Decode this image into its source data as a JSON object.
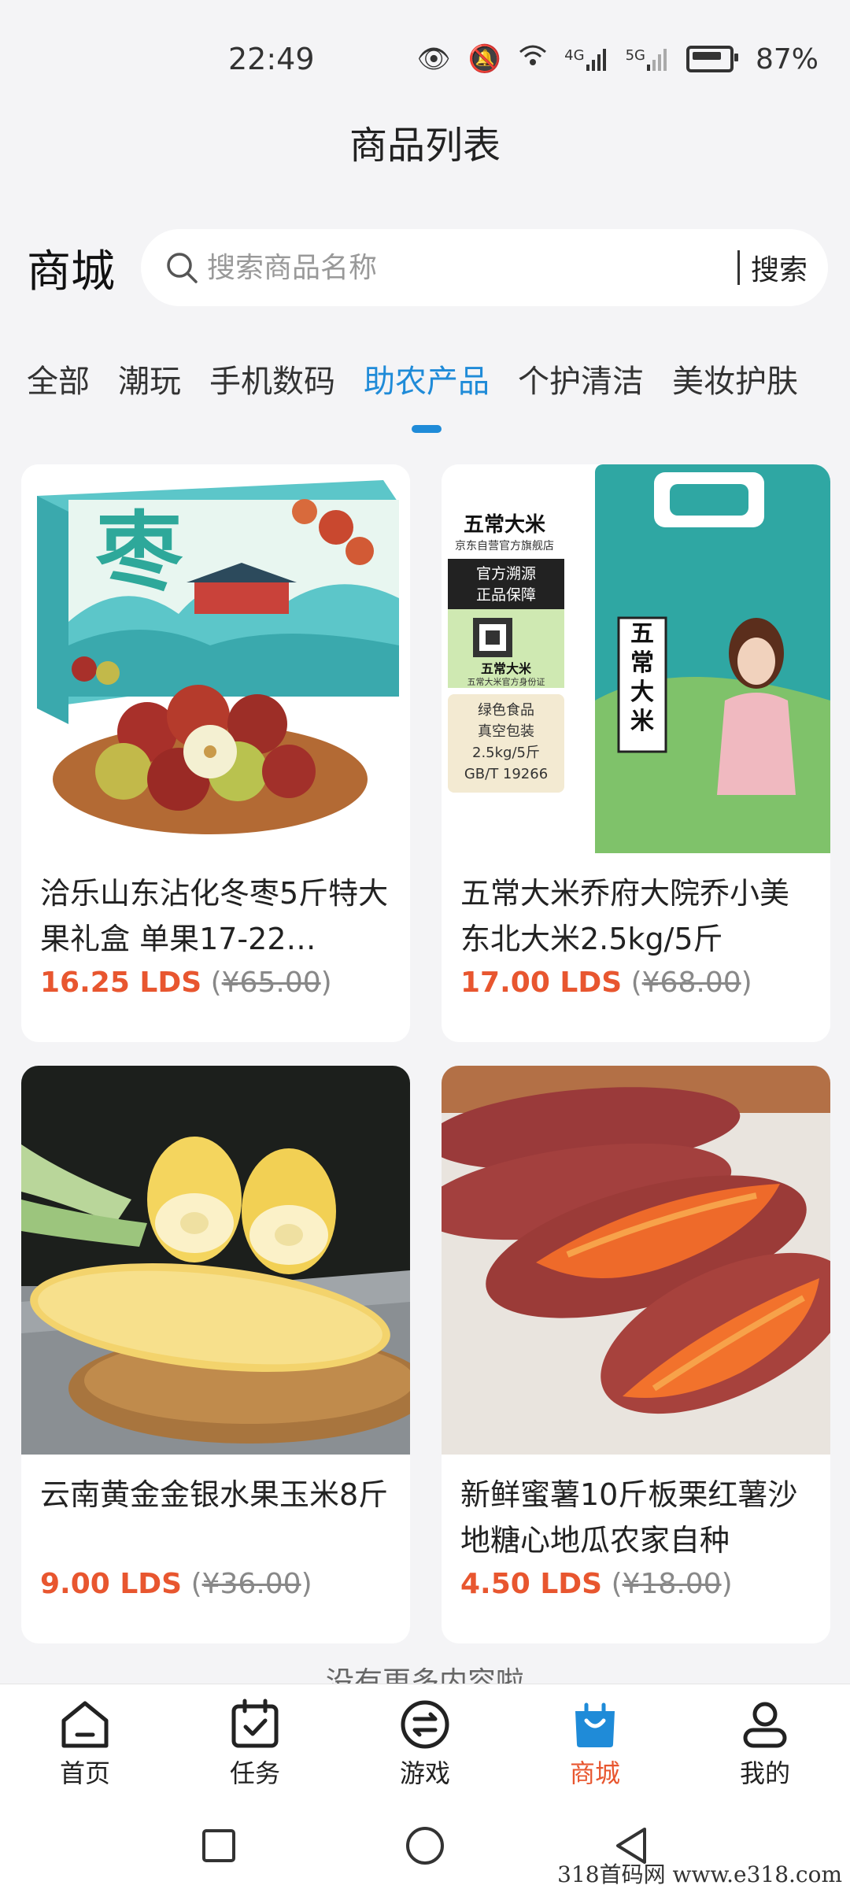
{
  "status_bar": {
    "time": "22:49",
    "network_1": "4G",
    "network_2": "5G",
    "battery": "87%"
  },
  "header": {
    "title": "商品列表"
  },
  "search": {
    "label": "商城",
    "placeholder": "搜索商品名称",
    "button": "搜索"
  },
  "tabs": [
    {
      "label": "全部",
      "active": false
    },
    {
      "label": "潮玩",
      "active": false
    },
    {
      "label": "手机数码",
      "active": false
    },
    {
      "label": "助农产品",
      "active": true
    },
    {
      "label": "个护清洁",
      "active": false
    },
    {
      "label": "美妆护肤",
      "active": false
    }
  ],
  "products": [
    {
      "name": "洽乐山东沾化冬枣5斤特大果礼盒 单果17-22…",
      "price": "16.25 LDS",
      "original": "¥65.00",
      "image": "winter-jujube-gift-box",
      "image_text": "枣"
    },
    {
      "name": "五常大米乔府大院乔小美东北大米2.5kg/5斤",
      "price": "17.00 LDS",
      "original": "¥68.00",
      "image": "wuchang-rice-bag",
      "image_text": {
        "brand": "五常大米",
        "store": "京东自营官方旗舰店",
        "badge": "官方溯源 正品保障",
        "id_brand": "五常大米",
        "id_text": "五常大米官方身份证",
        "spec_1": "绿色食品",
        "spec_2": "真空包装",
        "spec_3": "2.5kg/5斤",
        "spec_4": "GB/T 19266",
        "bag_title": "五常大米"
      }
    },
    {
      "name": "云南黄金金银水果玉米8斤",
      "price": "9.00 LDS",
      "original": "¥36.00",
      "image": "yellow-white-corn"
    },
    {
      "name": "新鲜蜜薯10斤板栗红薯沙地糖心地瓜农家自种",
      "price": "4.50 LDS",
      "original": "¥18.00",
      "image": "roasted-sweet-potato"
    }
  ],
  "end_text": "没有更多内容啦",
  "tabbar": [
    {
      "label": "首页",
      "icon": "home-icon",
      "active": false
    },
    {
      "label": "任务",
      "icon": "task-calendar-icon",
      "active": false
    },
    {
      "label": "游戏",
      "icon": "game-exchange-icon",
      "active": false
    },
    {
      "label": "商城",
      "icon": "shopping-bag-icon",
      "active": true
    },
    {
      "label": "我的",
      "icon": "profile-icon",
      "active": false
    }
  ],
  "system_nav": [
    "recent-apps-icon",
    "home-circle-icon",
    "back-triangle-icon"
  ],
  "watermark": "318首码网 www.e318.com",
  "colors": {
    "accent_blue": "#1f8bd8",
    "price_red": "#e8562f",
    "background": "#f4f4f6"
  }
}
